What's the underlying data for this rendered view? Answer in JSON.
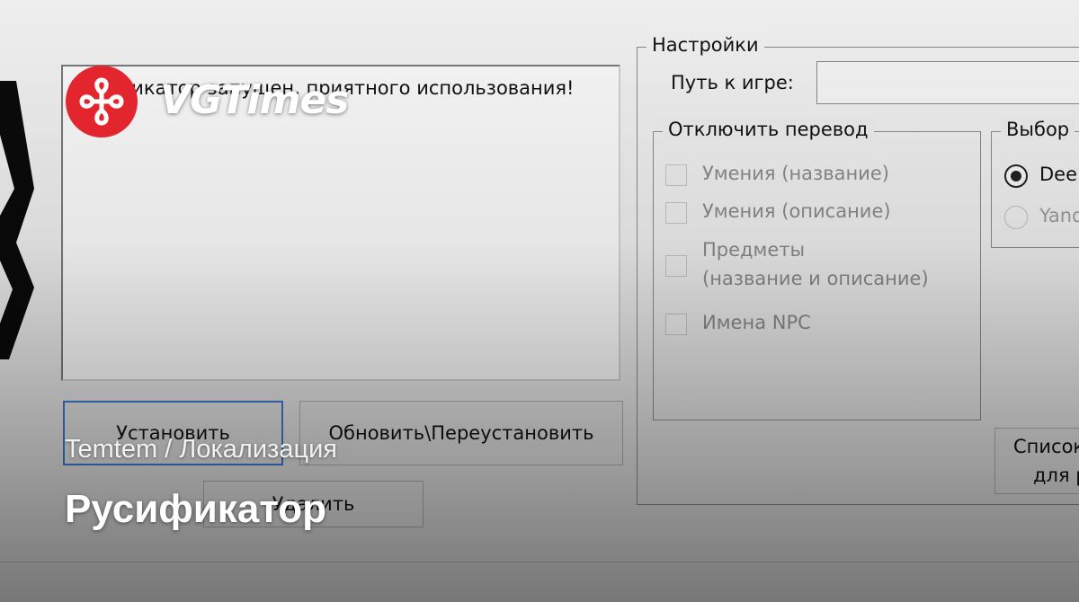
{
  "brand": {
    "name": "VGTimes",
    "logo_color": "#e3262e"
  },
  "log": {
    "text": "Русификатор запущен, приятного использования!"
  },
  "buttons": {
    "install": "Установить",
    "update": "Обновить\\Переустановить",
    "delete": "Удалить",
    "list_line1": "Список",
    "list_line2": "для р"
  },
  "settings": {
    "title": "Настройки",
    "path_label": "Путь к игре:",
    "path_value": ""
  },
  "disable_translation": {
    "title": "Отключить перевод",
    "items": [
      {
        "label": "Умения (название)",
        "checked": false
      },
      {
        "label": "Умения (описание)",
        "checked": false
      },
      {
        "label_line1": "Предметы",
        "label_line2": "(название и описание)",
        "checked": false
      },
      {
        "label": "Имена NPC",
        "checked": false
      }
    ]
  },
  "translator_choice": {
    "title": "Выбор",
    "options": [
      {
        "label": "Dee",
        "selected": true,
        "enabled": true
      },
      {
        "label": "Yand",
        "selected": false,
        "enabled": false
      }
    ]
  },
  "caption": {
    "breadcrumb": "Temtem / Локализация",
    "title": "Русификатор"
  }
}
